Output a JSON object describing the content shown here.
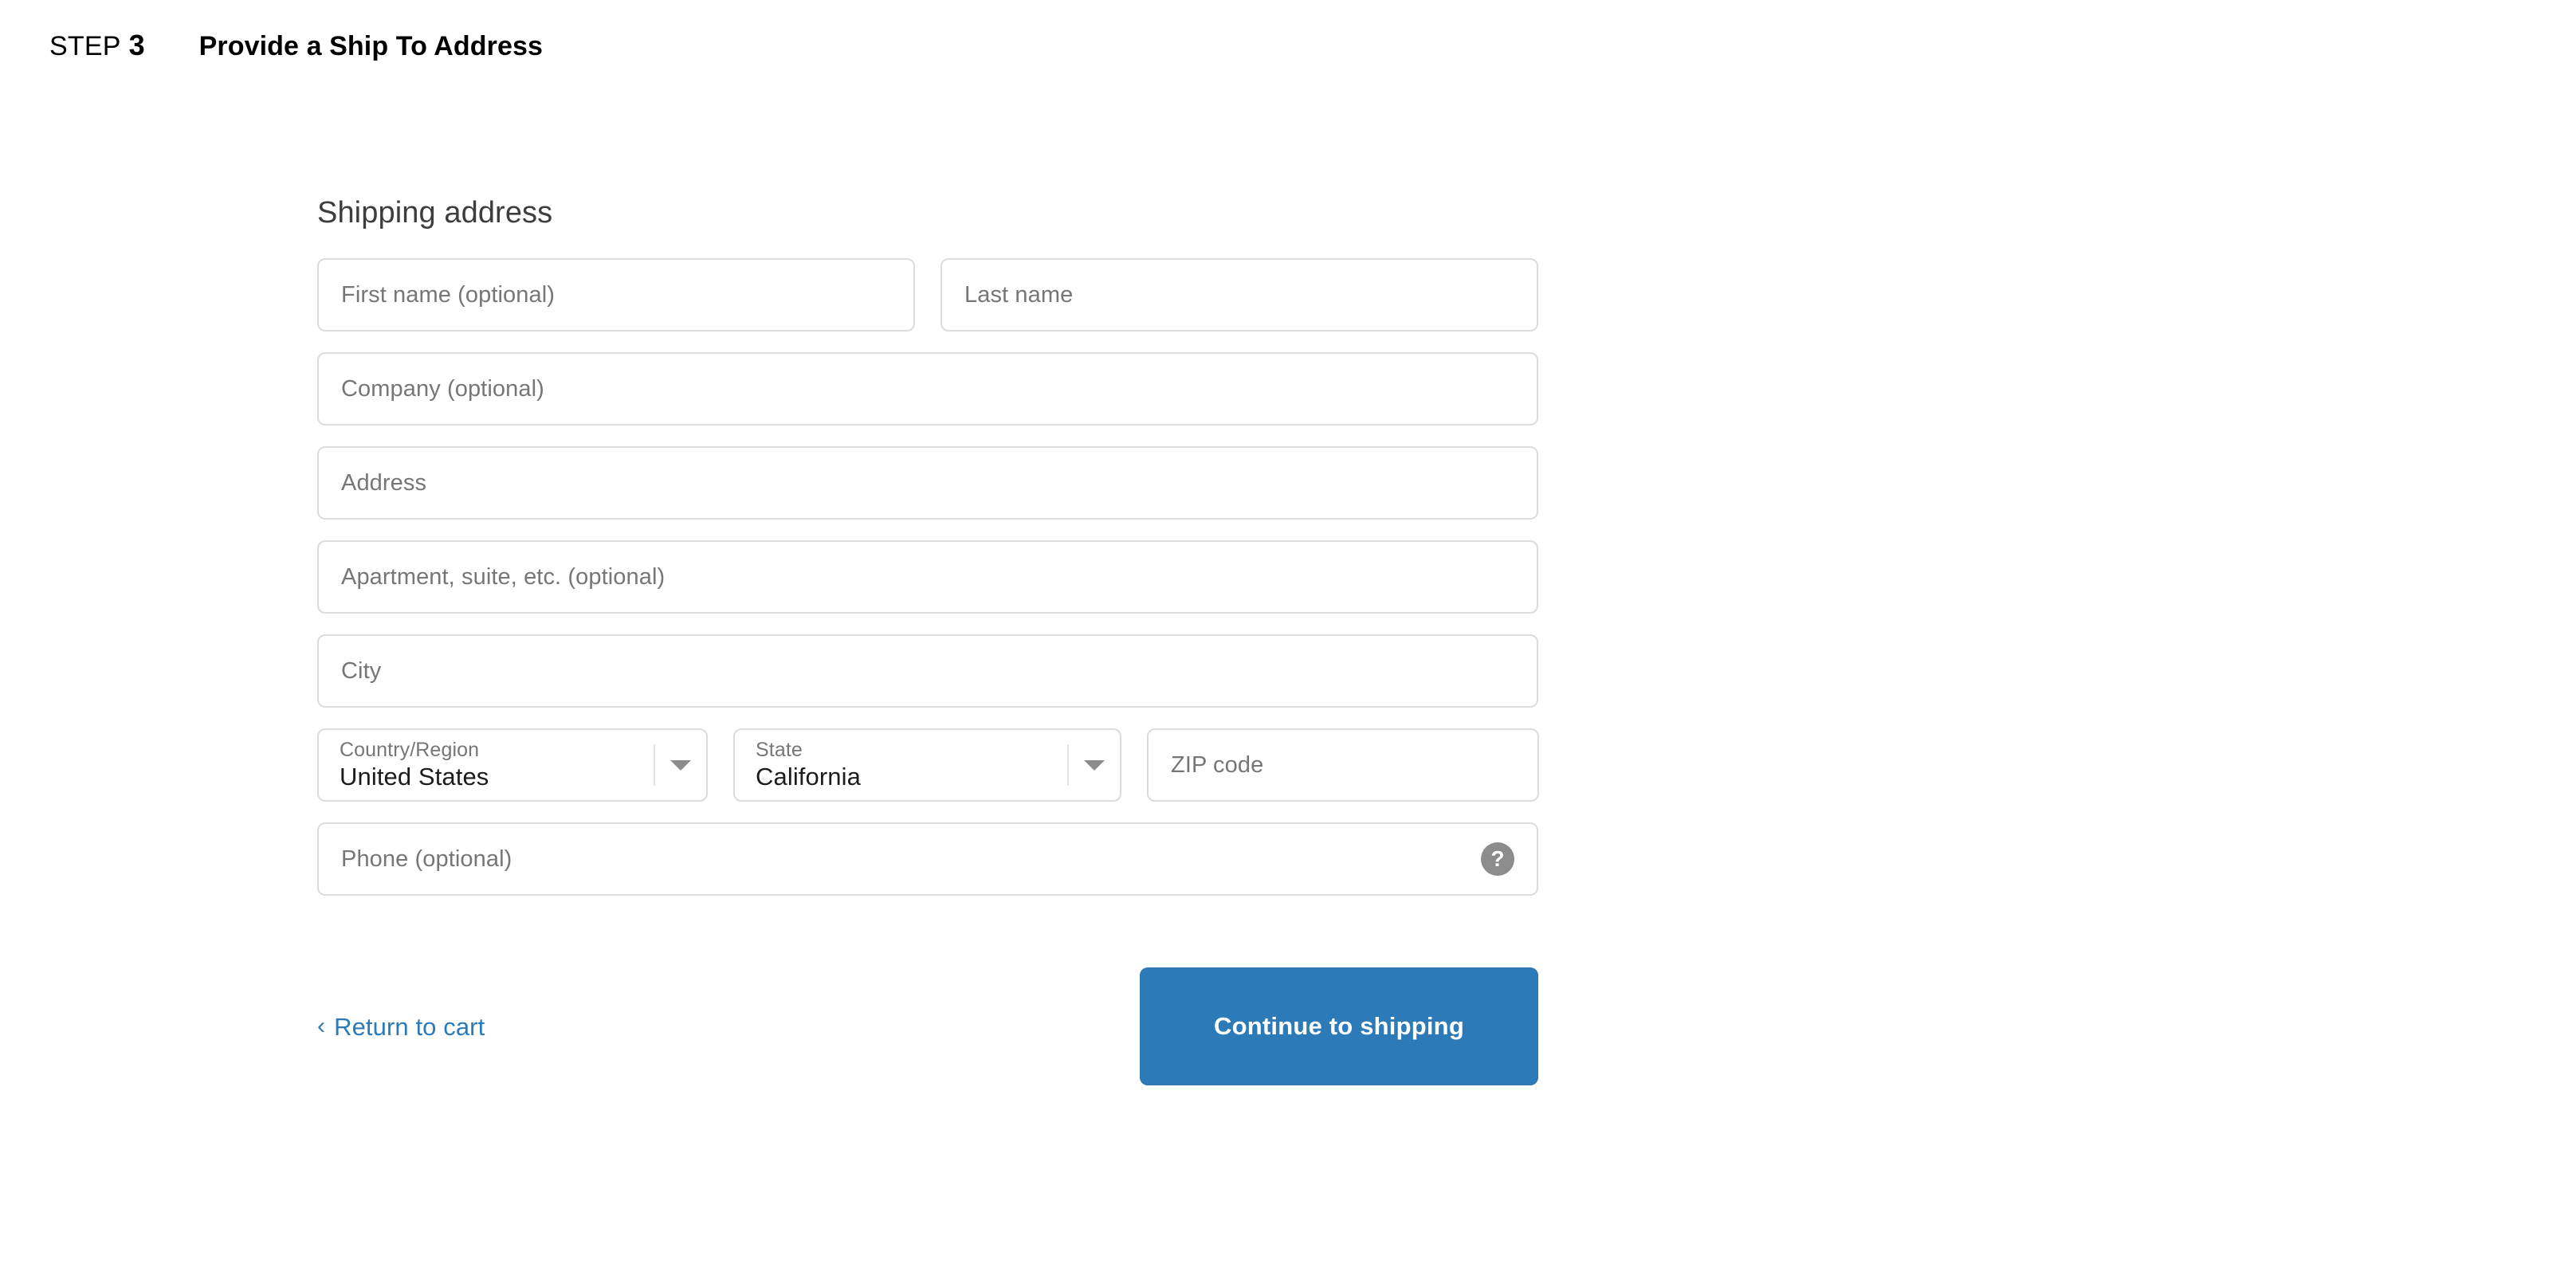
{
  "header": {
    "step_word": "STEP",
    "step_number": "3",
    "title": "Provide a Ship To Address"
  },
  "form": {
    "heading": "Shipping address",
    "fields": {
      "first_name": {
        "placeholder": "First name (optional)",
        "value": ""
      },
      "last_name": {
        "placeholder": "Last name",
        "value": ""
      },
      "company": {
        "placeholder": "Company (optional)",
        "value": ""
      },
      "address": {
        "placeholder": "Address",
        "value": ""
      },
      "apartment": {
        "placeholder": "Apartment, suite, etc. (optional)",
        "value": ""
      },
      "city": {
        "placeholder": "City",
        "value": ""
      },
      "country": {
        "label": "Country/Region",
        "value": "United States"
      },
      "state": {
        "label": "State",
        "value": "California"
      },
      "zip": {
        "placeholder": "ZIP code",
        "value": ""
      },
      "phone": {
        "placeholder": "Phone (optional)",
        "value": "",
        "help_icon": "help-circle-icon",
        "help_glyph": "?"
      }
    },
    "select_arrow_icon": "chevron-down-icon"
  },
  "actions": {
    "return_chevron_icon": "chevron-left-icon",
    "return_chevron_glyph": "‹",
    "return_label": "Return to cart",
    "continue_label": "Continue to shipping"
  },
  "colors": {
    "accent_blue": "#2d7ab8",
    "field_border": "#dcdcdc",
    "placeholder_text": "#767676",
    "value_text": "#1c1c1c",
    "heading_text": "#3d3d3d",
    "help_icon_bg": "#8c8c8c",
    "page_background": "#ffffff"
  }
}
